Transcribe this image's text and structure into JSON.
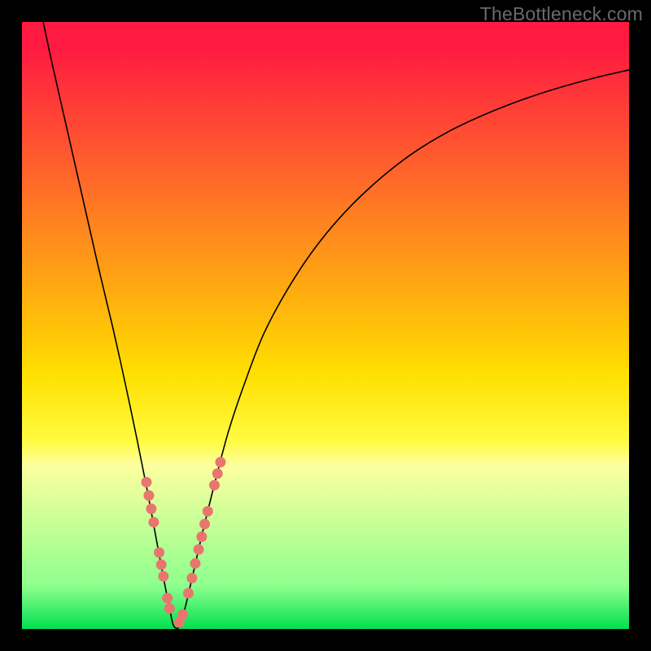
{
  "watermark": "TheBottleneck.com",
  "colors": {
    "background": "#000000",
    "gradient_top": "#ff1a41",
    "gradient_bottom": "#00e050",
    "curve": "#000000",
    "beads": "#e9766e"
  },
  "chart_data": {
    "type": "line",
    "title": "",
    "xlabel": "",
    "ylabel": "",
    "xlim": [
      0,
      100
    ],
    "ylim": [
      0,
      100
    ],
    "series": [
      {
        "name": "bottleneck-curve",
        "x": [
          3.5,
          5,
          7.5,
          10,
          12.5,
          15,
          17,
          19,
          20.7,
          22,
          23.3,
          24.3,
          25,
          26,
          27,
          28.5,
          30,
          32,
          34,
          36.5,
          40,
          45,
          50,
          56,
          63,
          70,
          78,
          86,
          94,
          100
        ],
        "y": [
          100,
          93,
          82,
          71,
          60,
          49.5,
          40.5,
          31,
          22.5,
          15.5,
          8.5,
          3.5,
          0.5,
          0.5,
          4,
          10.5,
          17,
          25,
          32.5,
          40,
          49,
          58,
          65,
          71.5,
          77.4,
          81.8,
          85.5,
          88.4,
          90.7,
          92.1
        ]
      }
    ],
    "beads_left": [
      {
        "x": 20.5,
        "y": 24.2
      },
      {
        "x": 20.9,
        "y": 22.0
      },
      {
        "x": 21.3,
        "y": 19.8
      },
      {
        "x": 21.7,
        "y": 17.6
      },
      {
        "x": 22.6,
        "y": 12.6
      },
      {
        "x": 22.95,
        "y": 10.6
      },
      {
        "x": 23.3,
        "y": 8.7
      },
      {
        "x": 23.95,
        "y": 5.1
      },
      {
        "x": 24.3,
        "y": 3.4
      }
    ],
    "beads_right": [
      {
        "x": 25.9,
        "y": 1.1
      },
      {
        "x": 26.5,
        "y": 2.4
      },
      {
        "x": 27.4,
        "y": 5.9
      },
      {
        "x": 28.0,
        "y": 8.4
      },
      {
        "x": 28.55,
        "y": 10.8
      },
      {
        "x": 29.1,
        "y": 13.1
      },
      {
        "x": 29.6,
        "y": 15.2
      },
      {
        "x": 30.1,
        "y": 17.3
      },
      {
        "x": 30.6,
        "y": 19.4
      },
      {
        "x": 31.7,
        "y": 23.7
      },
      {
        "x": 32.2,
        "y": 25.6
      },
      {
        "x": 32.7,
        "y": 27.5
      }
    ],
    "bead_radius_px": 6.5
  }
}
